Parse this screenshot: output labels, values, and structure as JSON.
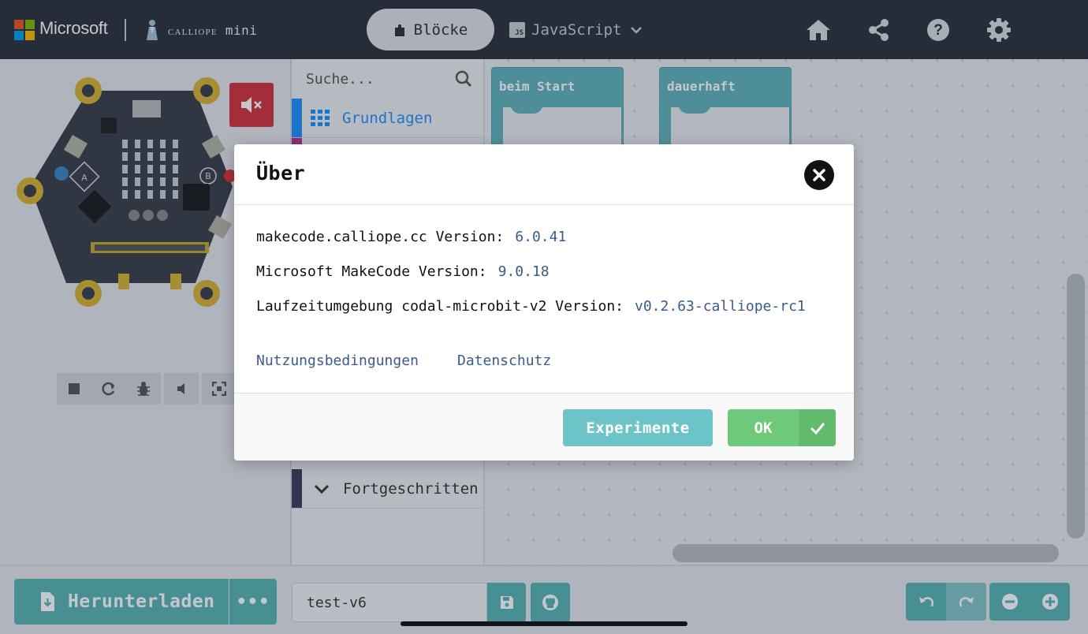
{
  "header": {
    "brand": "Microsoft",
    "product_small": "CALLIOPE",
    "product": "mini",
    "tabs": [
      {
        "label": "Blöcke",
        "icon": "puzzle-icon",
        "active": true
      },
      {
        "label": "JavaScript",
        "icon": "js-icon",
        "badge": "JS",
        "active": false
      }
    ],
    "actions": [
      "home-icon",
      "share-icon",
      "help-icon",
      "settings-icon"
    ]
  },
  "toolbox": {
    "search_placeholder": "Suche...",
    "categories": [
      {
        "label": "Grundlagen",
        "color": "#1e90ff",
        "icon": "grid-icon"
      },
      {
        "label": "Fortgeschritten",
        "color": "#3c3c5a",
        "icon": "chevron-down-icon"
      }
    ]
  },
  "workspace": {
    "blocks": [
      {
        "label": "beim Start"
      },
      {
        "label": "dauerhaft"
      }
    ]
  },
  "bottom": {
    "download_label": "Herunterladen",
    "more_label": "•••",
    "project_name": "test-v6"
  },
  "dialog": {
    "title": "Über",
    "rows": [
      {
        "label": "makecode.calliope.cc Version:",
        "value": "6.0.41"
      },
      {
        "label": "Microsoft MakeCode Version:",
        "value": "9.0.18"
      },
      {
        "label": "Laufzeitumgebung codal-microbit-v2 Version:",
        "value": "v0.2.63-calliope-rc1"
      }
    ],
    "links": [
      "Nutzungsbedingungen",
      "Datenschutz"
    ],
    "experiments_label": "Experimente",
    "ok_label": "OK"
  },
  "colors": {
    "header_bg": "#2c313a",
    "accent_teal": "#5ab5b5",
    "ok_green": "#6ec97a",
    "mute_red": "#d0333a",
    "block_teal": "#62b3bb",
    "link_blue": "#3a5c8a"
  }
}
